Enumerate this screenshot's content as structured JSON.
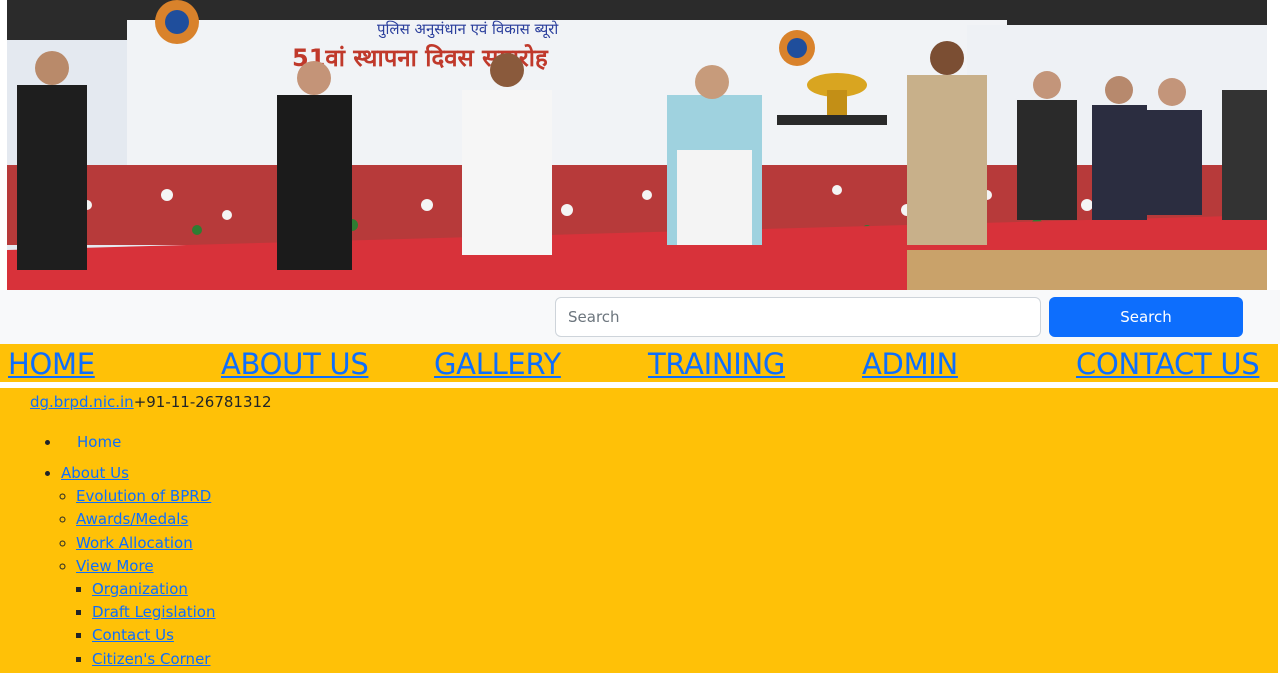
{
  "banner": {
    "image": "award-ceremony-photo",
    "banner_text_top": "पुलिस अनुसंधान एवं विकास ब्यूरो",
    "banner_text_main": "51वां स्थापना दिवस समारोह"
  },
  "search": {
    "placeholder": "Search",
    "button_label": "Search"
  },
  "nav": {
    "items": [
      {
        "label": "HOME"
      },
      {
        "label": "ABOUT US"
      },
      {
        "label": "GALLERY"
      },
      {
        "label": "TRAINING"
      },
      {
        "label": "ADMIN"
      },
      {
        "label": "CONTACT US"
      }
    ]
  },
  "contact": {
    "email": "dg.brpd.nic.in",
    "phone": "+91-11-26781312"
  },
  "menu": {
    "home": "Home",
    "about_us": "About Us",
    "about_children": [
      "Evolution of BPRD",
      "Awards/Medals",
      "Work Allocation",
      "View More"
    ],
    "view_more_children": [
      "Organization",
      "Draft Legislation",
      "Contact Us",
      "Citizen's Corner"
    ]
  },
  "colors": {
    "nav_bg": "#ffc107",
    "link": "#0d6efd",
    "search_button": "#0d6efd"
  }
}
